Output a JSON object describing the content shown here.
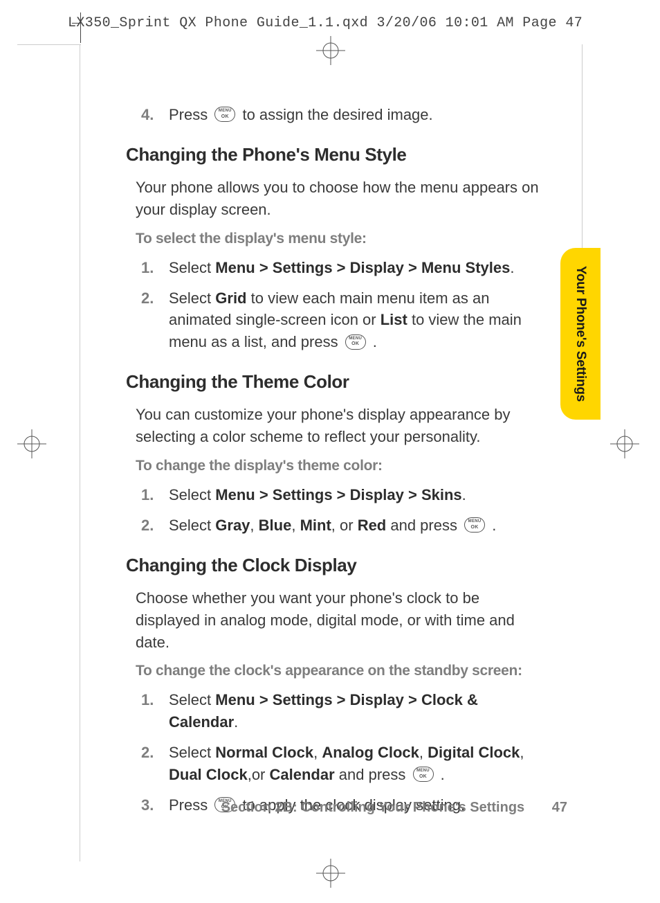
{
  "header": "LX350_Sprint QX Phone Guide_1.1.qxd  3/20/06  10:01 AM  Page 47",
  "sideTab": "Your Phone's Settings",
  "intro_step": {
    "num": "4.",
    "pre": "Press ",
    "post": " to assign the desired image."
  },
  "s1": {
    "title": "Changing the Phone's Menu Style",
    "para": "Your phone allows you to choose how the menu appears on your display screen.",
    "sub": "To select the display's menu style:",
    "step1": {
      "num": "1.",
      "pre": "Select ",
      "b1": "Menu > Settings > Display > Menu Styles",
      "post": "."
    },
    "step2": {
      "num": "2.",
      "pre": "Select ",
      "b1": "Grid",
      "mid1": " to view each main menu item as an animated single-screen icon or ",
      "b2": "List",
      "mid2": " to view the main menu as a list, and press ",
      "post": " ."
    }
  },
  "s2": {
    "title": "Changing the Theme Color",
    "para": "You can customize your phone's display appearance by selecting a color scheme to reflect your personality.",
    "sub": "To change the display's theme color:",
    "step1": {
      "num": "1.",
      "pre": "Select ",
      "b1": "Menu > Settings > Display > Skins",
      "post": "."
    },
    "step2": {
      "num": "2.",
      "pre": "Select ",
      "b1": "Gray",
      "c1": ", ",
      "b2": "Blue",
      "c2": ", ",
      "b3": "Mint",
      "c3": ", or ",
      "b4": "Red",
      "mid": " and press ",
      "post": " ."
    }
  },
  "s3": {
    "title": "Changing the Clock Display",
    "para": "Choose whether you want your phone's clock to be displayed in analog mode, digital mode, or with time and date.",
    "sub": "To change the clock's appearance on the standby screen:",
    "step1": {
      "num": "1.",
      "pre": "Select ",
      "b1": "Menu > Settings > Display > Clock & Calendar",
      "post": "."
    },
    "step2": {
      "num": "2.",
      "pre": "Select ",
      "b1": "Normal Clock",
      "c1": ", ",
      "b2": "Analog Clock",
      "c2": ", ",
      "b3": "Digital Clock",
      "c3": ", ",
      "b4": "Dual Clock",
      "c4": ",or ",
      "b5": "Calendar",
      "mid": " and press ",
      "post": " ."
    },
    "step3": {
      "num": "3.",
      "pre": "Press ",
      "post": " to apply the clock display setting."
    }
  },
  "footer": {
    "section": "Section 2B: Controlling Your Phone's Settings",
    "page": "47"
  }
}
